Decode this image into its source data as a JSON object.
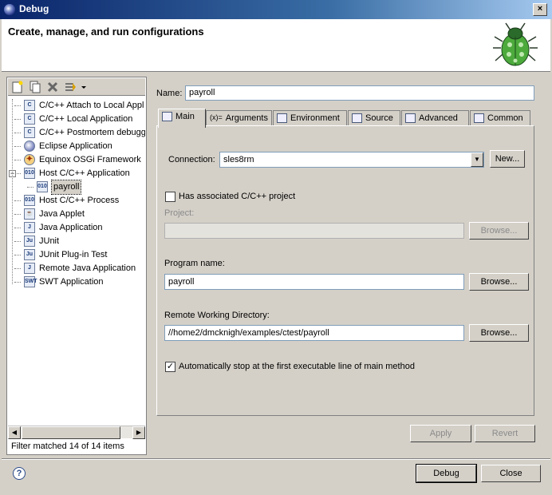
{
  "window": {
    "title": "Debug",
    "close_label": "×"
  },
  "header": {
    "title": "Create, manage, and run configurations"
  },
  "tree": {
    "items": [
      {
        "label": "C/C++ Attach to Local Appl",
        "icon": "C",
        "level": 0
      },
      {
        "label": "C/C++ Local Application",
        "icon": "C",
        "level": 0
      },
      {
        "label": "C/C++ Postmortem debugg",
        "icon": "C",
        "level": 0
      },
      {
        "label": "Eclipse Application",
        "icon": "eclipse",
        "level": 0
      },
      {
        "label": "Equinox OSGi Framework",
        "icon": "osgi",
        "level": 0
      },
      {
        "label": "Host C/C++ Application",
        "icon": "010",
        "level": 0,
        "expanded": true
      },
      {
        "label": "payroll",
        "icon": "010",
        "level": 1,
        "selected": true
      },
      {
        "label": "Host C/C++ Process",
        "icon": "010",
        "level": 0
      },
      {
        "label": "Java Applet",
        "icon": "applet",
        "level": 0
      },
      {
        "label": "Java Application",
        "icon": "J",
        "level": 0
      },
      {
        "label": "JUnit",
        "icon": "Ju",
        "level": 0
      },
      {
        "label": "JUnit Plug-in Test",
        "icon": "Ju",
        "level": 0
      },
      {
        "label": "Remote Java Application",
        "icon": "J",
        "level": 0
      },
      {
        "label": "SWT Application",
        "icon": "SWT",
        "level": 0
      }
    ],
    "filter_text": "Filter matched 14 of 14 items"
  },
  "name": {
    "label": "Name:",
    "value": "payroll"
  },
  "tabs": [
    {
      "label": "Main",
      "active": true
    },
    {
      "label": "Arguments"
    },
    {
      "label": "Environment"
    },
    {
      "label": "Source"
    },
    {
      "label": "Advanced"
    },
    {
      "label": "Common"
    }
  ],
  "main": {
    "connection_label": "Connection:",
    "connection_value": "sles8rm",
    "new_button": "New...",
    "associated_project_label": "Has associated C/C++ project",
    "project_label": "Project:",
    "project_value": "",
    "browse_label": "Browse...",
    "program_name_label": "Program name:",
    "program_name_value": "payroll",
    "remote_dir_label": "Remote Working Directory:",
    "remote_dir_value": "//home2/dmcknigh/examples/ctest/payroll",
    "auto_stop_label": "Automatically stop at the first executable line of main method"
  },
  "buttons": {
    "apply": "Apply",
    "revert": "Revert",
    "debug": "Debug",
    "close": "Close"
  },
  "icons": [
    "eclipse-icon",
    "bug-logo-icon",
    "new-config-icon",
    "duplicate-icon",
    "delete-icon",
    "collapse-icon",
    "help-icon"
  ]
}
